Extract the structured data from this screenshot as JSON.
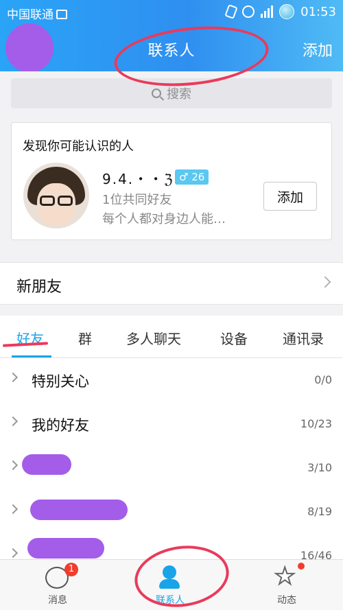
{
  "statusbar": {
    "carrier": "中国联通",
    "time": "01:53"
  },
  "header": {
    "title": "联系人",
    "add_label": "添加"
  },
  "search": {
    "placeholder": "搜索"
  },
  "suggest": {
    "heading": "发现你可能认识的人",
    "name": "9.4.・・ℨ",
    "badge": "26",
    "mutual": "1位共同好友",
    "desc": "每个人都对身边人能…",
    "add_label": "添加"
  },
  "newfriends": {
    "label": "新朋友"
  },
  "tabs": [
    "好友",
    "群",
    "多人聊天",
    "设备",
    "通讯录"
  ],
  "groups": [
    {
      "name": "特别关心",
      "count": "0/0"
    },
    {
      "name": "我的好友",
      "count": "10/23"
    },
    {
      "name": "",
      "count": "3/10"
    },
    {
      "name": "",
      "count": "8/19"
    },
    {
      "name": "",
      "count": "16/46"
    }
  ],
  "bottomnav": {
    "messages": "消息",
    "contacts": "联系人",
    "feed": "动态",
    "messages_badge": "1"
  },
  "colors": {
    "header": "#2f8ff0",
    "accent": "#19a4e8",
    "badge_red": "#f23c2c"
  }
}
